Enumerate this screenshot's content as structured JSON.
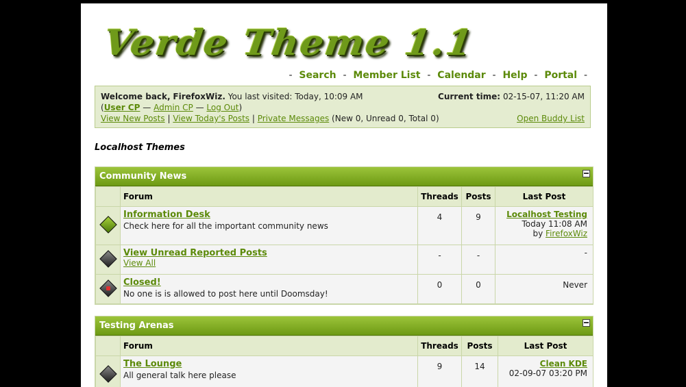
{
  "logo": {
    "text": "Verde Theme 1.1"
  },
  "nav": {
    "items": [
      {
        "label": "Search"
      },
      {
        "label": "Member List"
      },
      {
        "label": "Calendar"
      },
      {
        "label": "Help"
      },
      {
        "label": "Portal"
      }
    ],
    "separator": "-"
  },
  "welcome": {
    "greeting": "Welcome back,",
    "username": "FirefoxWiz.",
    "last_visited": "You last visited: Today, 10:09 AM",
    "current_time_label": "Current time:",
    "current_time_value": "02-15-07, 11:20 AM",
    "user_cp": "User CP",
    "admin_cp": "Admin CP",
    "log_out": "Log Out",
    "dash": "—",
    "view_new_posts": "View New Posts",
    "view_todays_posts": "View Today's Posts",
    "private_messages": "Private Messages",
    "pm_counts": "(New 0, Unread 0, Total 0)",
    "open_buddy_list": "Open Buddy List"
  },
  "breadcrumb": "Localhost Themes",
  "columns": {
    "forum": "Forum",
    "threads": "Threads",
    "posts": "Posts",
    "last_post": "Last Post"
  },
  "categories": [
    {
      "title": "Community News",
      "forums": [
        {
          "name": "Information Desk",
          "desc": "Check here for all the important community news",
          "threads": "4",
          "posts": "9",
          "last_title": "Localhost Testing",
          "last_time": "Today 11:08 AM",
          "last_by": "by",
          "last_user": "FirefoxWiz",
          "icon": "green-diamond-icon"
        },
        {
          "name": "View Unread Reported Posts",
          "desc": "View All",
          "threads": "-",
          "posts": "-",
          "last_title": "-",
          "icon": "gray-diamond-icon"
        },
        {
          "name": "Closed!",
          "desc": "No one is is allowed to post here until Doomsday!",
          "threads": "0",
          "posts": "0",
          "last_title": "Never",
          "icon": "locked-diamond-icon"
        }
      ]
    },
    {
      "title": "Testing Arenas",
      "forums": [
        {
          "name": "The Lounge",
          "desc": "All general talk here please",
          "threads": "9",
          "posts": "14",
          "last_title": "Clean KDE",
          "last_time": "02-09-07 03:20 PM",
          "icon": "gray-diamond-icon"
        }
      ]
    }
  ]
}
